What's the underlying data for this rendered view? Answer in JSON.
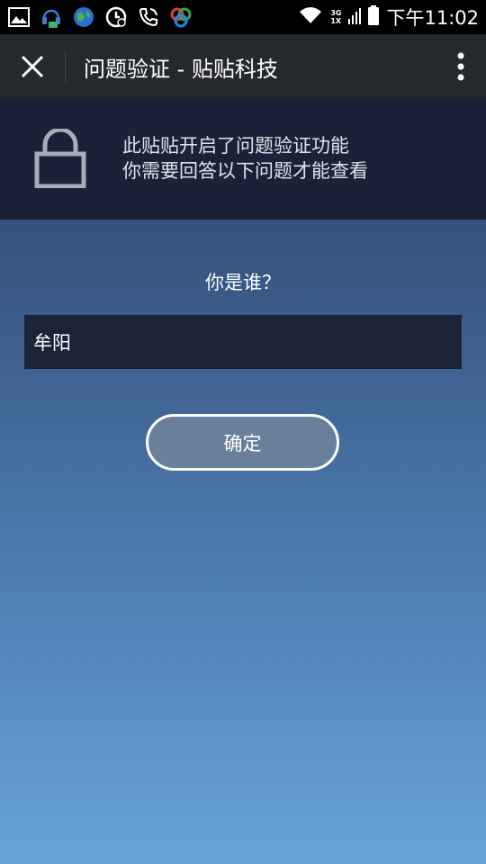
{
  "status_bar": {
    "time": "下午11:02",
    "network_top": "3G",
    "network_bottom": "1X",
    "icons": [
      "gallery-icon",
      "headset-icon",
      "globe-icon",
      "clock-icon",
      "phone-icon",
      "app-icon",
      "wifi-icon",
      "signal-icon",
      "battery-icon"
    ]
  },
  "toolbar": {
    "title": "问题验证 - 贴贴科技"
  },
  "notice": {
    "line1": "此贴贴开启了问题验证功能",
    "line2": "你需要回答以下问题才能查看"
  },
  "form": {
    "question": "你是谁？",
    "answer_value": "牟阳",
    "confirm_label": "确定"
  }
}
